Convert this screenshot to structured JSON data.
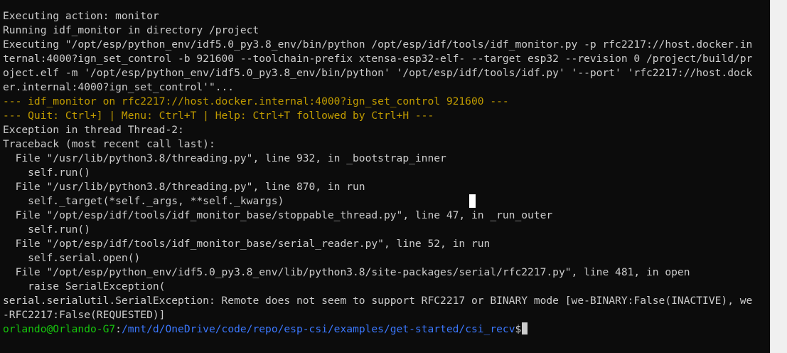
{
  "terminal": {
    "lines": [
      {
        "text": "Executing action: monitor",
        "style": "normal"
      },
      {
        "text": "Running idf_monitor in directory /project",
        "style": "normal"
      },
      {
        "text": "Executing \"/opt/esp/python_env/idf5.0_py3.8_env/bin/python /opt/esp/idf/tools/idf_monitor.py -p rfc2217://host.docker.in",
        "style": "normal"
      },
      {
        "text": "ternal:4000?ign_set_control -b 921600 --toolchain-prefix xtensa-esp32-elf- --target esp32 --revision 0 /project/build/pr",
        "style": "normal"
      },
      {
        "text": "oject.elf -m '/opt/esp/python_env/idf5.0_py3.8_env/bin/python' '/opt/esp/idf/tools/idf.py' '--port' 'rfc2217://host.dock",
        "style": "normal"
      },
      {
        "text": "er.internal:4000?ign_set_control'\"...",
        "style": "normal"
      },
      {
        "text": "--- idf_monitor on rfc2217://host.docker.internal:4000?ign_set_control 921600 ---",
        "style": "yellow"
      },
      {
        "text": "--- Quit: Ctrl+] | Menu: Ctrl+T | Help: Ctrl+T followed by Ctrl+H ---",
        "style": "yellow"
      },
      {
        "text": "Exception in thread Thread-2:",
        "style": "normal"
      },
      {
        "text": "Traceback (most recent call last):",
        "style": "normal"
      },
      {
        "text": "  File \"/usr/lib/python3.8/threading.py\", line 932, in _bootstrap_inner",
        "style": "normal"
      },
      {
        "text": "    self.run()",
        "style": "normal"
      },
      {
        "text": "  File \"/usr/lib/python3.8/threading.py\", line 870, in run",
        "style": "normal"
      },
      {
        "text": "    self._target(*self._args, **self._kwargs)",
        "style": "normal"
      },
      {
        "text": "  File \"/opt/esp/idf/tools/idf_monitor_base/stoppable_thread.py\", line 47, in _run_outer",
        "style": "normal"
      },
      {
        "text": "    self.run()",
        "style": "normal"
      },
      {
        "text": "  File \"/opt/esp/idf/tools/idf_monitor_base/serial_reader.py\", line 52, in run",
        "style": "normal"
      },
      {
        "text": "    self.serial.open()",
        "style": "normal"
      },
      {
        "text": "  File \"/opt/esp/python_env/idf5.0_py3.8_env/lib/python3.8/site-packages/serial/rfc2217.py\", line 481, in open",
        "style": "normal"
      },
      {
        "text": "    raise SerialException(",
        "style": "normal"
      },
      {
        "text": "serial.serialutil.SerialException: Remote does not seem to support RFC2217 or BINARY mode [we-BINARY:False(INACTIVE), we",
        "style": "normal"
      },
      {
        "text": "-RFC2217:False(REQUESTED)]",
        "style": "normal"
      }
    ],
    "prompt": {
      "user_host": "orlando@Orlando-G7",
      "separator": ":",
      "path": "/mnt/d/OneDrive/code/repo/esp-csi/examples/get-started/csi_recv",
      "symbol": "$"
    }
  },
  "colors": {
    "background": "#0c0c0c",
    "foreground": "#cccccc",
    "monitor_banner": "#c19c00",
    "prompt_user": "#16c60c",
    "prompt_path": "#3b78ff"
  }
}
